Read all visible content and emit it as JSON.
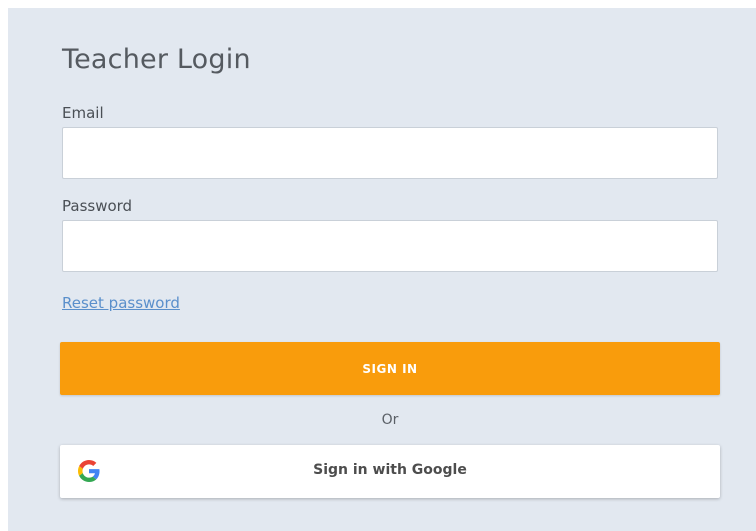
{
  "form": {
    "title": "Teacher Login",
    "email_label": "Email",
    "email_value": "",
    "password_label": "Password",
    "password_value": "",
    "reset_link": "Reset password",
    "signin_label": "SIGN IN",
    "or_text": "Or",
    "google_label": "Sign in with Google",
    "google_icon": "google-g-icon"
  },
  "colors": {
    "panel_bg": "#e2e8f0",
    "signin_bg": "#f99c0c",
    "link": "#5a8fcb"
  }
}
